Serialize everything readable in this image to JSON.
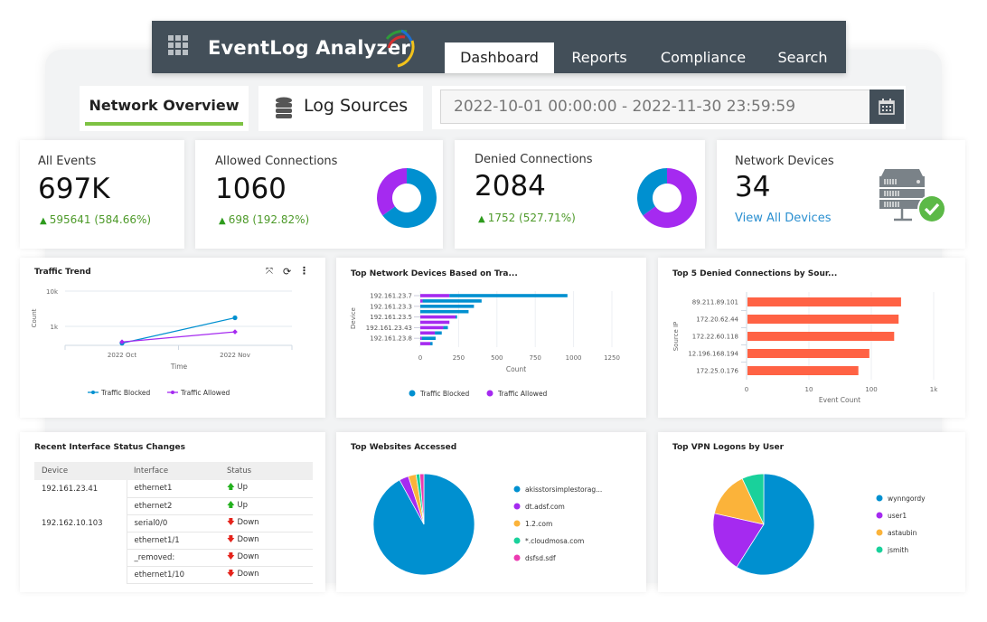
{
  "app": {
    "title": "EventLog Analyzer",
    "nav": [
      "Dashboard",
      "Reports",
      "Compliance",
      "Search"
    ],
    "active_nav": "Dashboard"
  },
  "subtabs": {
    "network_overview": "Network Overview",
    "log_sources": "Log Sources"
  },
  "date_range": "2022-10-01 00:00:00 - 2022-11-30 23:59:59",
  "colors": {
    "header": "#434f59",
    "accent_green": "#7dc242",
    "blue": "#0090d0",
    "purple": "#a52af0",
    "orange": "#fbb33a",
    "teal": "#19d19b",
    "pink": "#ec3ab1",
    "bar_red": "#ff6244"
  },
  "kpis": {
    "all_events": {
      "title": "All Events",
      "value": "697K",
      "delta": "595641 (584.66%)"
    },
    "allowed": {
      "title": "Allowed Connections",
      "value": "1060",
      "delta": "698 (192.82%)",
      "donut": [
        {
          "color": "#0090d0",
          "value": 65
        },
        {
          "color": "#a52af0",
          "value": 35
        }
      ]
    },
    "denied": {
      "title": "Denied Connections",
      "value": "2084",
      "delta": "1752 (527.71%)",
      "donut": [
        {
          "color": "#a52af0",
          "value": 65
        },
        {
          "color": "#0090d0",
          "value": 35
        }
      ]
    },
    "devices": {
      "title": "Network Devices",
      "value": "34",
      "link": "View All Devices",
      "icon": "server-check-icon"
    }
  },
  "chart_data": [
    {
      "id": "traffic",
      "type": "line",
      "title": "Traffic Trend",
      "xlabel": "Time",
      "ylabel": "Count",
      "yscale": "log",
      "yticks": [
        "1k",
        "10k"
      ],
      "categories": [
        "2022 Oct",
        "2022 Nov"
      ],
      "series": [
        {
          "name": "Traffic Blocked",
          "color": "#0090d0",
          "values": [
            332,
            1752
          ]
        },
        {
          "name": "Traffic Allowed",
          "color": "#a52af0",
          "values": [
            362,
            698
          ]
        }
      ]
    },
    {
      "id": "devices",
      "type": "bar",
      "orientation": "horizontal",
      "stacked": true,
      "title": "Top Network Devices Based on Tra...",
      "xlabel": "Count",
      "ylabel": "Device",
      "xlim": [
        0,
        1250
      ],
      "xticks": [
        "0",
        "250",
        "500",
        "750",
        "1000",
        "1250"
      ],
      "categories": [
        "192.161.23.7",
        "",
        "192.161.23.3",
        "",
        "192.161.23.5",
        "",
        "192.161.23.43",
        "",
        "192.161.23.8",
        ""
      ],
      "series": [
        {
          "name": "Traffic Allowed",
          "color": "#a52af0",
          "values": [
            190,
            15,
            0,
            0,
            230,
            190,
            150,
            95,
            10,
            65
          ]
        },
        {
          "name": "Traffic Blocked",
          "color": "#0090d0",
          "values": [
            770,
            385,
            350,
            315,
            10,
            0,
            30,
            45,
            90,
            15
          ]
        }
      ],
      "legend": [
        {
          "name": "Traffic Blocked",
          "color": "#0090d0"
        },
        {
          "name": "Traffic Allowed",
          "color": "#a52af0"
        }
      ]
    },
    {
      "id": "denied",
      "type": "bar",
      "orientation": "horizontal",
      "title": "Top 5 Denied Connections by Sour...",
      "xlabel": "Event Count",
      "ylabel": "Source IP",
      "xscale": "log",
      "xticks": [
        "0",
        "10",
        "100",
        "1k"
      ],
      "categories": [
        "89.211.89.101",
        "172.20.62.44",
        "172.22.60.118",
        "12.196.168.194",
        "172.25.0.176"
      ],
      "values": [
        290,
        265,
        225,
        90,
        60
      ],
      "color": "#ff6244"
    },
    {
      "id": "websites",
      "type": "pie",
      "title": "Top Websites Accessed",
      "labels": [
        "akisstorsimplestorag...",
        "dt.adsf.com",
        "1.2.com",
        "*.cloudmosa.com",
        "dsfsd.sdf"
      ],
      "values": [
        92,
        3,
        2.5,
        1.2,
        1.3
      ],
      "colors": [
        "#0090d0",
        "#a52af0",
        "#fbb33a",
        "#19d19b",
        "#ec3ab1"
      ]
    },
    {
      "id": "vpn",
      "type": "pie",
      "title": "Top VPN Logons by User",
      "labels": [
        "wynngordy",
        "user1",
        "astaubin",
        "jsmith"
      ],
      "values": [
        59,
        19.5,
        14.5,
        7
      ],
      "colors": [
        "#0090d0",
        "#a52af0",
        "#fbb33a",
        "#19d19b"
      ]
    }
  ],
  "interface_table": {
    "title": "Recent Interface Status Changes",
    "headers": [
      "Device",
      "Interface",
      "Status"
    ],
    "rows": [
      [
        "192.161.23.41",
        "ethernet1",
        "Up"
      ],
      [
        "",
        "ethernet2",
        "Up"
      ],
      [
        "192.162.10.103",
        "serial0/0",
        "Down"
      ],
      [
        "",
        "ethernet1/1",
        "Down"
      ],
      [
        "",
        "_removed:",
        "Down"
      ],
      [
        "",
        "ethernet1/10",
        "Down"
      ]
    ]
  }
}
